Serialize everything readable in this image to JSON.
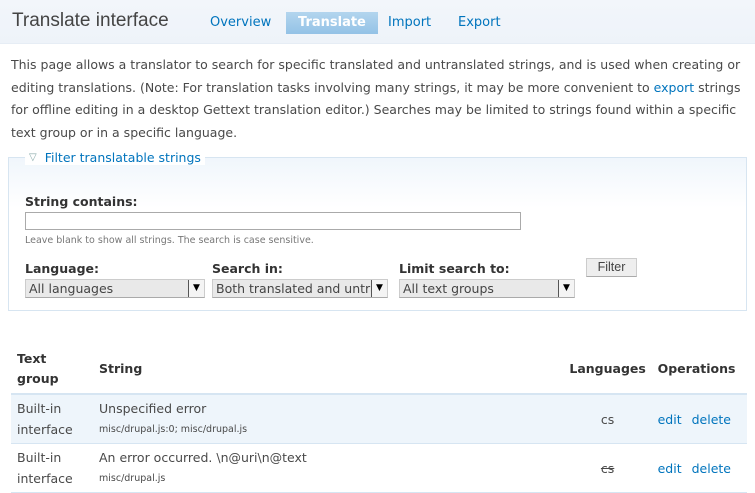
{
  "header": {
    "title": "Translate interface",
    "tabs": [
      {
        "label": "Overview"
      },
      {
        "label": "Translate"
      },
      {
        "label": "Import"
      },
      {
        "label": "Export"
      }
    ]
  },
  "intro": {
    "text_before": "This page allows a translator to search for specific translated and untranslated strings, and is used when creating or editing translations. (Note: For translation tasks involving many strings, it may be more convenient to ",
    "link": "export",
    "text_after": " strings for offline editing in a desktop Gettext translation editor.) Searches may be limited to strings found within a specific text group or in a specific language."
  },
  "filter": {
    "legend": "Filter translatable strings",
    "string_label": "String contains:",
    "string_value": "",
    "string_desc": "Leave blank to show all strings. The search is case sensitive.",
    "language_label": "Language:",
    "language_value": "All languages",
    "search_label": "Search in:",
    "search_value": "Both translated and untranslated strings",
    "limit_label": "Limit search to:",
    "limit_value": "All text groups",
    "button": "Filter"
  },
  "table": {
    "headers": [
      "Text group",
      "String",
      "Languages",
      "Operations"
    ],
    "rows": [
      {
        "group": "Built-in interface",
        "string": "Unspecified error",
        "location": "misc/drupal.js:0; misc/drupal.js",
        "lang": "cs",
        "edit": "edit",
        "delete": "delete"
      },
      {
        "group": "Built-in interface",
        "string": "An error occurred. \\n@uri\\n@text",
        "location": "misc/drupal.js",
        "lang": "cs",
        "edit": "edit",
        "delete": "delete"
      }
    ]
  }
}
